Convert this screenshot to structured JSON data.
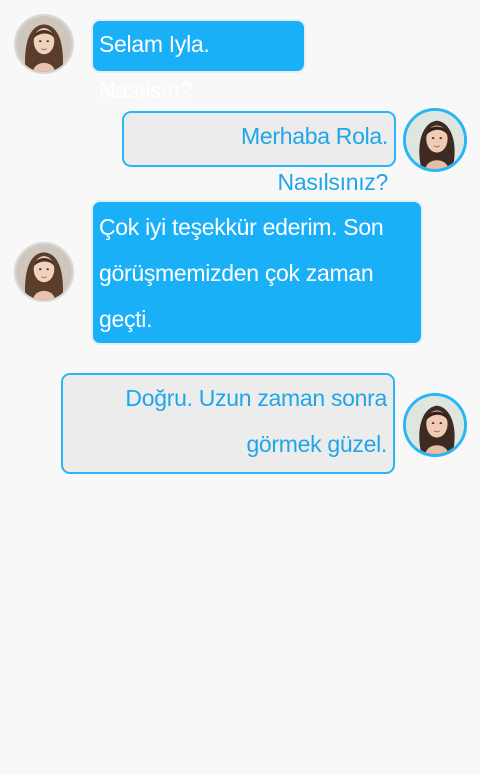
{
  "colors": {
    "background": "#f8f8f8",
    "incoming_bubble": "#1ab0f8",
    "incoming_text": "#ffffff",
    "outgoing_bubble": "#ececec",
    "outgoing_text": "#1fa6e8",
    "outgoing_border": "#29b6f6"
  },
  "messages": [
    {
      "direction": "incoming",
      "avatar": "woman-long-hair-avatar",
      "text": "Selam Iyla. Nasılsın?"
    },
    {
      "direction": "outgoing",
      "avatar": "woman-dark-hair-avatar",
      "text": "Merhaba Rola. Nasılsınız?"
    },
    {
      "direction": "incoming",
      "avatar": "woman-long-hair-avatar",
      "text": "Çok iyi teşekkür ederim. Son görüşmemizden çok zaman geçti."
    },
    {
      "direction": "outgoing",
      "avatar": "woman-dark-hair-avatar",
      "text": "Doğru. Uzun zaman sonra görmek güzel."
    }
  ]
}
